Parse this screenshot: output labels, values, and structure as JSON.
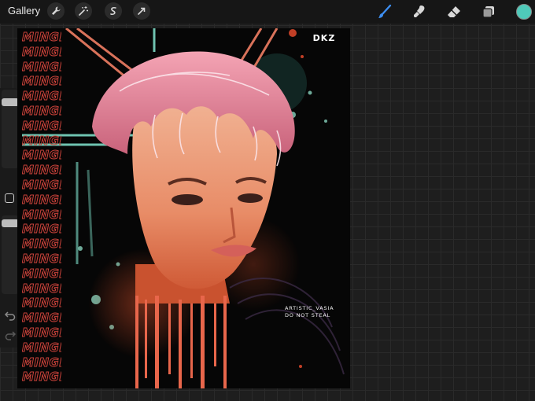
{
  "topbar": {
    "gallery_label": "Gallery",
    "left_tools": [
      "wrench-icon",
      "magic-wand-icon",
      "selection-icon",
      "transform-arrow-icon"
    ],
    "right_tools": [
      "brush-icon",
      "smudge-icon",
      "eraser-icon",
      "layers-icon"
    ],
    "active_color": "#4fc9b9",
    "brush_active_color": "#3d8ef0"
  },
  "canvas": {
    "repeated_text": "MINGI",
    "repeat_count": 24,
    "logo_text": "DKZ",
    "caption_line1": "ARTISTIC_VASIA",
    "caption_line2": "DO NOT STEAL"
  },
  "sidebar": {
    "brush_size_level": 0.12,
    "opacity_level": 0.05
  }
}
